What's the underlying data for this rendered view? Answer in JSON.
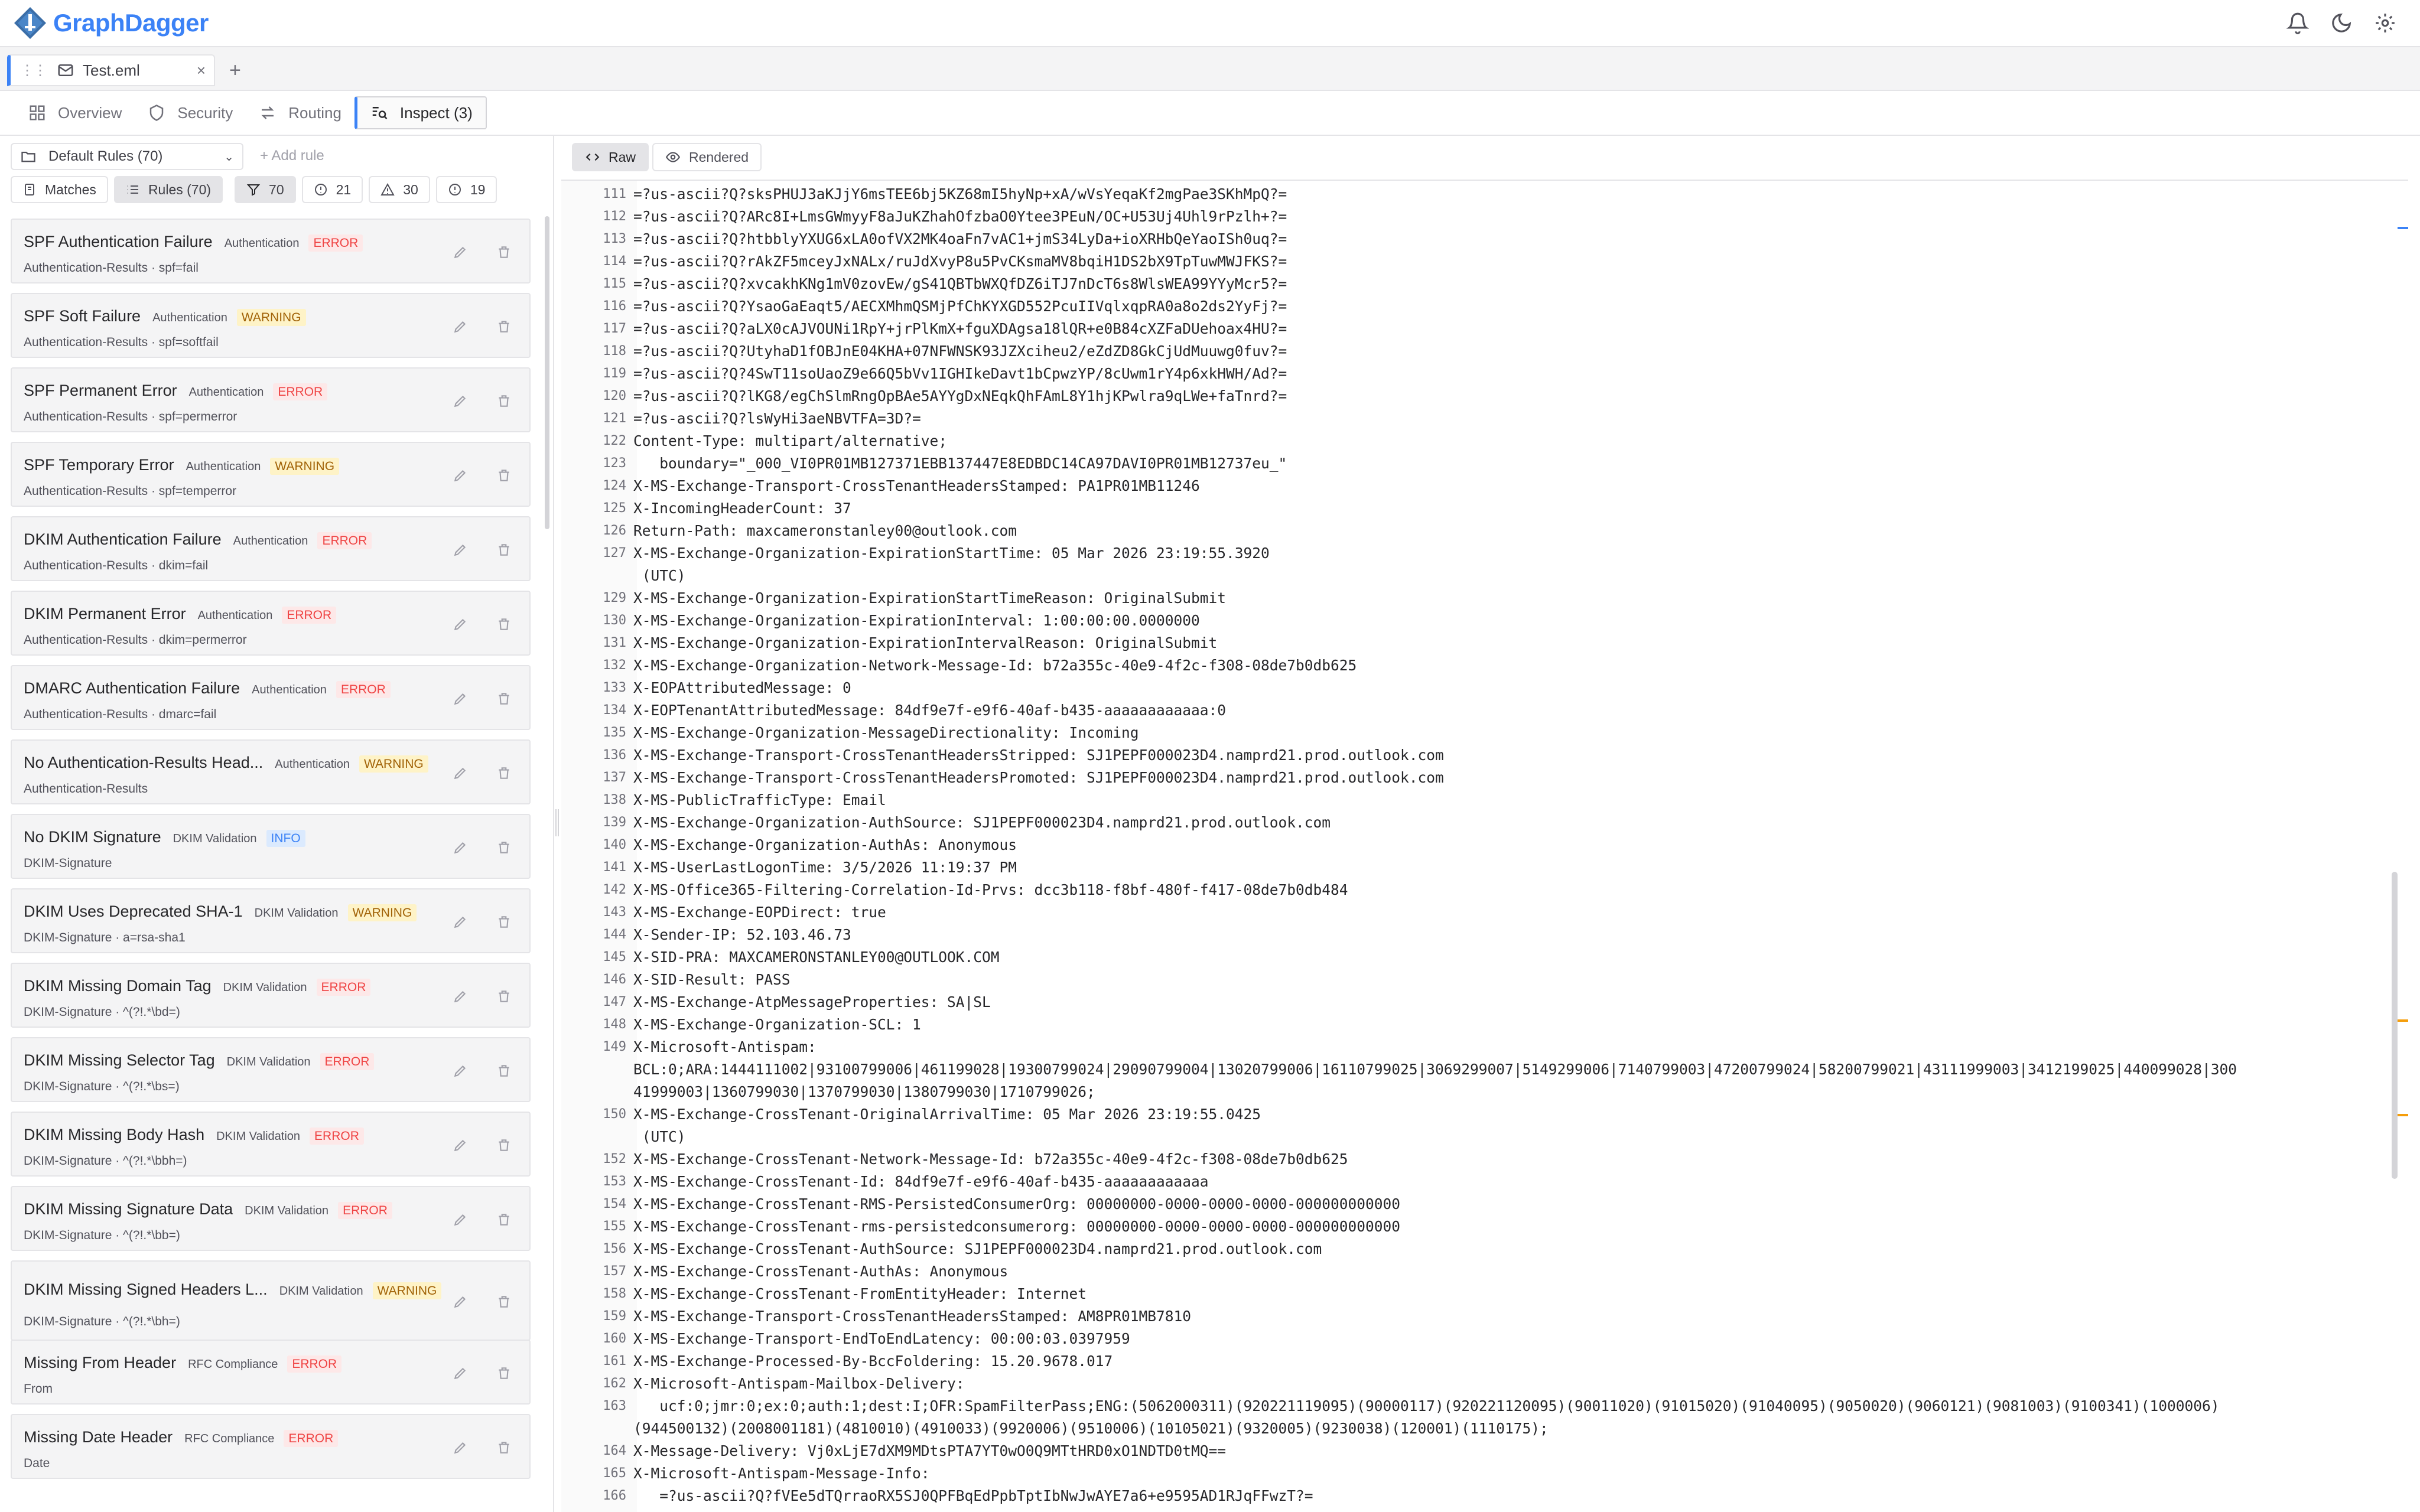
{
  "app": {
    "name": "GraphDagger"
  },
  "file_tab": {
    "name": "Test.eml",
    "close": "×",
    "add": "+"
  },
  "nav": {
    "tabs": [
      {
        "label": "Overview"
      },
      {
        "label": "Security"
      },
      {
        "label": "Routing"
      },
      {
        "label": "Inspect (3)"
      }
    ]
  },
  "left": {
    "ruleset": "Default Rules (70)",
    "add_rule": "+ Add rule",
    "matches_label": "Matches",
    "rules_label": "Rules (70)",
    "count_all": "70",
    "count_info": "21",
    "count_warning": "30",
    "count_error": "19",
    "rules": [
      {
        "title": "SPF Authentication Failure",
        "category": "Authentication",
        "severity": "ERROR",
        "sub": "Authentication-Results · spf=fail"
      },
      {
        "title": "SPF Soft Failure",
        "category": "Authentication",
        "severity": "WARNING",
        "sub": "Authentication-Results · spf=softfail"
      },
      {
        "title": "SPF Permanent Error",
        "category": "Authentication",
        "severity": "ERROR",
        "sub": "Authentication-Results · spf=permerror"
      },
      {
        "title": "SPF Temporary Error",
        "category": "Authentication",
        "severity": "WARNING",
        "sub": "Authentication-Results · spf=temperror"
      },
      {
        "title": "DKIM Authentication Failure",
        "category": "Authentication",
        "severity": "ERROR",
        "sub": "Authentication-Results · dkim=fail"
      },
      {
        "title": "DKIM Permanent Error",
        "category": "Authentication",
        "severity": "ERROR",
        "sub": "Authentication-Results · dkim=permerror"
      },
      {
        "title": "DMARC Authentication Failure",
        "category": "Authentication",
        "severity": "ERROR",
        "sub": "Authentication-Results · dmarc=fail"
      },
      {
        "title": "No Authentication-Results Head...",
        "category": "Authentication",
        "severity": "WARNING",
        "sub": "Authentication-Results"
      },
      {
        "title": "No DKIM Signature",
        "category": "DKIM Validation",
        "severity": "INFO",
        "sub": "DKIM-Signature"
      },
      {
        "title": "DKIM Uses Deprecated SHA-1",
        "category": "DKIM Validation",
        "severity": "WARNING",
        "sub": "DKIM-Signature · a=rsa-sha1"
      },
      {
        "title": "DKIM Missing Domain Tag",
        "category": "DKIM Validation",
        "severity": "ERROR",
        "sub": "DKIM-Signature · ^(?!.*\\bd=)"
      },
      {
        "title": "DKIM Missing Selector Tag",
        "category": "DKIM Validation",
        "severity": "ERROR",
        "sub": "DKIM-Signature · ^(?!.*\\bs=)"
      },
      {
        "title": "DKIM Missing Body Hash",
        "category": "DKIM Validation",
        "severity": "ERROR",
        "sub": "DKIM-Signature · ^(?!.*\\bbh=)"
      },
      {
        "title": "DKIM Missing Signature Data",
        "category": "DKIM Validation",
        "severity": "ERROR",
        "sub": "DKIM-Signature · ^(?!.*\\bb=)"
      },
      {
        "title": "DKIM Missing Signed Headers L...",
        "category": "DKIM Validation",
        "severity": "WARNING",
        "sub": "DKIM-Signature · ^(?!.*\\bh=)"
      },
      {
        "title": "Missing From Header",
        "category": "RFC Compliance",
        "severity": "ERROR",
        "sub": "From"
      },
      {
        "title": "Missing Date Header",
        "category": "RFC Compliance",
        "severity": "ERROR",
        "sub": "Date"
      }
    ]
  },
  "right": {
    "raw_label": "Raw",
    "rendered_label": "Rendered",
    "lines": [
      {
        "n": "111",
        "rows": [
          "=?us-ascii?Q?sksPHUJ3aKJjY6msTEE6bj5KZ68mI5hyNp+xA/wVsYeqaKf2mgPae3SKhMpQ?="
        ]
      },
      {
        "n": "112",
        "rows": [
          "=?us-ascii?Q?ARc8I+LmsGWmyyF8aJuKZhahOfzbaO0Ytee3PEuN/OC+U53Uj4Uhl9rPzlh+?="
        ]
      },
      {
        "n": "113",
        "rows": [
          "=?us-ascii?Q?htbblyYXUG6xLA0ofVX2MK4oaFn7vAC1+jmS34LyDa+ioXRHbQeYaoISh0uq?="
        ]
      },
      {
        "n": "114",
        "rows": [
          "=?us-ascii?Q?rAkZF5mceyJxNALx/ruJdXvyP8u5PvCKsmaMV8bqiH1DS2bX9TpTuwMWJFKS?="
        ]
      },
      {
        "n": "115",
        "rows": [
          "=?us-ascii?Q?xvcakhKNg1mV0zovEw/gS41QBTbWXQfDZ6iTJ7nDcT6s8WlsWEA99YYyMcr5?="
        ]
      },
      {
        "n": "116",
        "rows": [
          "=?us-ascii?Q?YsaoGaEaqt5/AECXMhmQSMjPfChKYXGD552PcuIIVqlxqpRA0a8o2ds2YyFj?="
        ]
      },
      {
        "n": "117",
        "rows": [
          "=?us-ascii?Q?aLX0cAJVOUNi1RpY+jrPlKmX+fguXDAgsa18lQR+e0B84cXZFaDUehoax4HU?="
        ]
      },
      {
        "n": "118",
        "rows": [
          "=?us-ascii?Q?UtyhaD1fOBJnE04KHA+07NFWNSK93JZXciheu2/eZdZD8GkCjUdMuuwg0fuv?="
        ]
      },
      {
        "n": "119",
        "rows": [
          "=?us-ascii?Q?4SwT11soUaoZ9e66Q5bVv1IGHIkeDavt1bCpwzYP/8cUwm1rY4p6xkHWH/Ad?="
        ]
      },
      {
        "n": "120",
        "rows": [
          "=?us-ascii?Q?lKG8/egChSlmRngOpBAe5AYYgDxNEqkQhFAmL8Y1hjKPwlra9qLWe+faTnrd?="
        ]
      },
      {
        "n": "121",
        "rows": [
          "=?us-ascii?Q?lsWyHi3aeNBVTFA=3D?="
        ]
      },
      {
        "n": "122",
        "rows": [
          "Content-Type: multipart/alternative;"
        ]
      },
      {
        "n": "123",
        "rows": [
          "   boundary=\"_000_VI0PR01MB127371EBB137447E8EDBDC14CA97DAVI0PR01MB12737eu_\""
        ]
      },
      {
        "n": "124",
        "rows": [
          "X-MS-Exchange-Transport-CrossTenantHeadersStamped: PA1PR01MB11246"
        ]
      },
      {
        "n": "125",
        "rows": [
          "X-IncomingHeaderCount: 37"
        ]
      },
      {
        "n": "126",
        "rows": [
          "Return-Path: maxcameronstanley00@outlook.com"
        ]
      },
      {
        "n": "127",
        "rows": [
          "X-MS-Exchange-Organization-ExpirationStartTime: 05 Mar 2026 23:19:55.3920",
          " (UTC)"
        ]
      },
      {
        "n": "129",
        "rows": [
          "X-MS-Exchange-Organization-ExpirationStartTimeReason: OriginalSubmit"
        ]
      },
      {
        "n": "130",
        "rows": [
          "X-MS-Exchange-Organization-ExpirationInterval: 1:00:00:00.0000000"
        ]
      },
      {
        "n": "131",
        "rows": [
          "X-MS-Exchange-Organization-ExpirationIntervalReason: OriginalSubmit"
        ]
      },
      {
        "n": "132",
        "rows": [
          "X-MS-Exchange-Organization-Network-Message-Id: b72a355c-40e9-4f2c-f308-08de7b0db625"
        ]
      },
      {
        "n": "133",
        "rows": [
          "X-EOPAttributedMessage: 0"
        ]
      },
      {
        "n": "134",
        "rows": [
          "X-EOPTenantAttributedMessage: 84df9e7f-e9f6-40af-b435-aaaaaaaaaaaa:0"
        ]
      },
      {
        "n": "135",
        "rows": [
          "X-MS-Exchange-Organization-MessageDirectionality: Incoming"
        ]
      },
      {
        "n": "136",
        "rows": [
          "X-MS-Exchange-Transport-CrossTenantHeadersStripped: SJ1PEPF000023D4.namprd21.prod.outlook.com"
        ]
      },
      {
        "n": "137",
        "rows": [
          "X-MS-Exchange-Transport-CrossTenantHeadersPromoted: SJ1PEPF000023D4.namprd21.prod.outlook.com"
        ]
      },
      {
        "n": "138",
        "rows": [
          "X-MS-PublicTrafficType: Email"
        ]
      },
      {
        "n": "139",
        "rows": [
          "X-MS-Exchange-Organization-AuthSource: SJ1PEPF000023D4.namprd21.prod.outlook.com"
        ]
      },
      {
        "n": "140",
        "rows": [
          "X-MS-Exchange-Organization-AuthAs: Anonymous"
        ]
      },
      {
        "n": "141",
        "rows": [
          "X-MS-UserLastLogonTime: 3/5/2026 11:19:37 PM"
        ]
      },
      {
        "n": "142",
        "rows": [
          "X-MS-Office365-Filtering-Correlation-Id-Prvs: dcc3b118-f8bf-480f-f417-08de7b0db484"
        ]
      },
      {
        "n": "143",
        "rows": [
          "X-MS-Exchange-EOPDirect: true"
        ]
      },
      {
        "n": "144",
        "rows": [
          "X-Sender-IP: 52.103.46.73"
        ]
      },
      {
        "n": "145",
        "rows": [
          "X-SID-PRA: MAXCAMERONSTANLEY00@OUTLOOK.COM"
        ]
      },
      {
        "n": "146",
        "rows": [
          "X-SID-Result: PASS"
        ]
      },
      {
        "n": "147",
        "rows": [
          "X-MS-Exchange-AtpMessageProperties: SA|SL"
        ]
      },
      {
        "n": "148",
        "rows": [
          "X-MS-Exchange-Organization-SCL: 1"
        ]
      },
      {
        "n": "149",
        "rows": [
          "X-Microsoft-Antispam:",
          "BCL:0;ARA:1444111002|93100799006|461199028|19300799024|29090799004|13020799006|16110799025|3069299007|5149299006|7140799003|47200799024|58200799021|43111999003|3412199025|440099028|300",
          "41999003|1360799030|1370799030|1380799030|1710799026;"
        ]
      },
      {
        "n": "150",
        "rows": [
          "X-MS-Exchange-CrossTenant-OriginalArrivalTime: 05 Mar 2026 23:19:55.0425",
          " (UTC)"
        ]
      },
      {
        "n": "152",
        "rows": [
          "X-MS-Exchange-CrossTenant-Network-Message-Id: b72a355c-40e9-4f2c-f308-08de7b0db625"
        ]
      },
      {
        "n": "153",
        "rows": [
          "X-MS-Exchange-CrossTenant-Id: 84df9e7f-e9f6-40af-b435-aaaaaaaaaaaa"
        ]
      },
      {
        "n": "154",
        "rows": [
          "X-MS-Exchange-CrossTenant-RMS-PersistedConsumerOrg: 00000000-0000-0000-0000-000000000000"
        ]
      },
      {
        "n": "155",
        "rows": [
          "X-MS-Exchange-CrossTenant-rms-persistedconsumerorg: 00000000-0000-0000-0000-000000000000"
        ]
      },
      {
        "n": "156",
        "rows": [
          "X-MS-Exchange-CrossTenant-AuthSource: SJ1PEPF000023D4.namprd21.prod.outlook.com"
        ]
      },
      {
        "n": "157",
        "rows": [
          "X-MS-Exchange-CrossTenant-AuthAs: Anonymous"
        ]
      },
      {
        "n": "158",
        "rows": [
          "X-MS-Exchange-CrossTenant-FromEntityHeader: Internet"
        ]
      },
      {
        "n": "159",
        "rows": [
          "X-MS-Exchange-Transport-CrossTenantHeadersStamped: AM8PR01MB7810"
        ]
      },
      {
        "n": "160",
        "rows": [
          "X-MS-Exchange-Transport-EndToEndLatency: 00:00:03.0397959"
        ]
      },
      {
        "n": "161",
        "rows": [
          "X-MS-Exchange-Processed-By-BccFoldering: 15.20.9678.017"
        ]
      },
      {
        "n": "162",
        "rows": [
          "X-Microsoft-Antispam-Mailbox-Delivery:"
        ]
      },
      {
        "n": "163",
        "rows": [
          "   ucf:0;jmr:0;ex:0;auth:1;dest:I;OFR:SpamFilterPass;ENG:(5062000311)(920221119095)(90000117)(920221120095)(90011020)(91015020)(91040095)(9050020)(9060121)(9081003)(9100341)(1000006)",
          "(944500132)(2008001181)(4810010)(4910033)(9920006)(9510006)(10105021)(9320005)(9230038)(120001)(1110175);"
        ]
      },
      {
        "n": "164",
        "rows": [
          "X-Message-Delivery: Vj0xLjE7dXM9MDtsPTA7YT0wO0Q9MTtHRD0xO1NDTD0tMQ=="
        ]
      },
      {
        "n": "165",
        "rows": [
          "X-Microsoft-Antispam-Message-Info:"
        ]
      },
      {
        "n": "166",
        "rows": [
          "   =?us-ascii?Q?fVEe5dTQrraoRX5SJ0QPFBqEdPpbTptIbNwJwAYE7a6+e9595AD1RJqFFwzT?="
        ]
      }
    ]
  }
}
